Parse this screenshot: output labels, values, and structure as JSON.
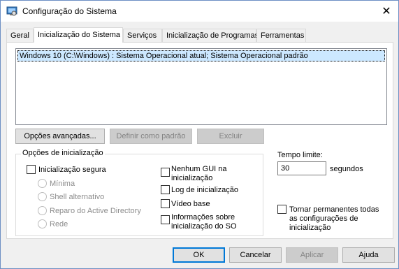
{
  "window": {
    "title": "Configuração do Sistema",
    "app_icon": "system-config-icon",
    "close_glyph": "✕"
  },
  "tabs": [
    {
      "label": "Geral",
      "active": false
    },
    {
      "label": "Inicialização do Sistema",
      "active": true
    },
    {
      "label": "Serviços",
      "active": false
    },
    {
      "label": "Inicialização de Programas",
      "active": false
    },
    {
      "label": "Ferramentas",
      "active": false
    }
  ],
  "boot_list": {
    "items": [
      "Windows 10 (C:\\Windows) : Sistema Operacional atual; Sistema Operacional padrão"
    ]
  },
  "boot_buttons": {
    "advanced": "Opções avançadas...",
    "set_default": "Definir como padrão",
    "delete": "Excluir"
  },
  "boot_options": {
    "group_label": "Opções de inicialização",
    "safe_boot": "Inicialização segura",
    "minimal": "Mínima",
    "alternate_shell": "Shell alternativo",
    "ad_repair": "Reparo do Active Directory",
    "network": "Rede",
    "no_gui_1": "Nenhum GUI na",
    "no_gui_2": "inicialização",
    "boot_log": "Log de inicialização",
    "base_video": "Vídeo base",
    "os_info_1": "Informações sobre",
    "os_info_2": "inicialização do SO"
  },
  "timeout": {
    "label": "Tempo limite:",
    "value": "30",
    "unit": "segundos"
  },
  "permanent": {
    "line1": "Tornar permanentes todas",
    "line2": "as configurações de",
    "line3": "inicialização"
  },
  "footer": {
    "ok": "OK",
    "cancel": "Cancelar",
    "apply": "Aplicar",
    "help": "Ajuda"
  },
  "colors": {
    "selection": "#cce8ff",
    "default_button_border": "#0078d7",
    "disabled_text": "#838383"
  }
}
